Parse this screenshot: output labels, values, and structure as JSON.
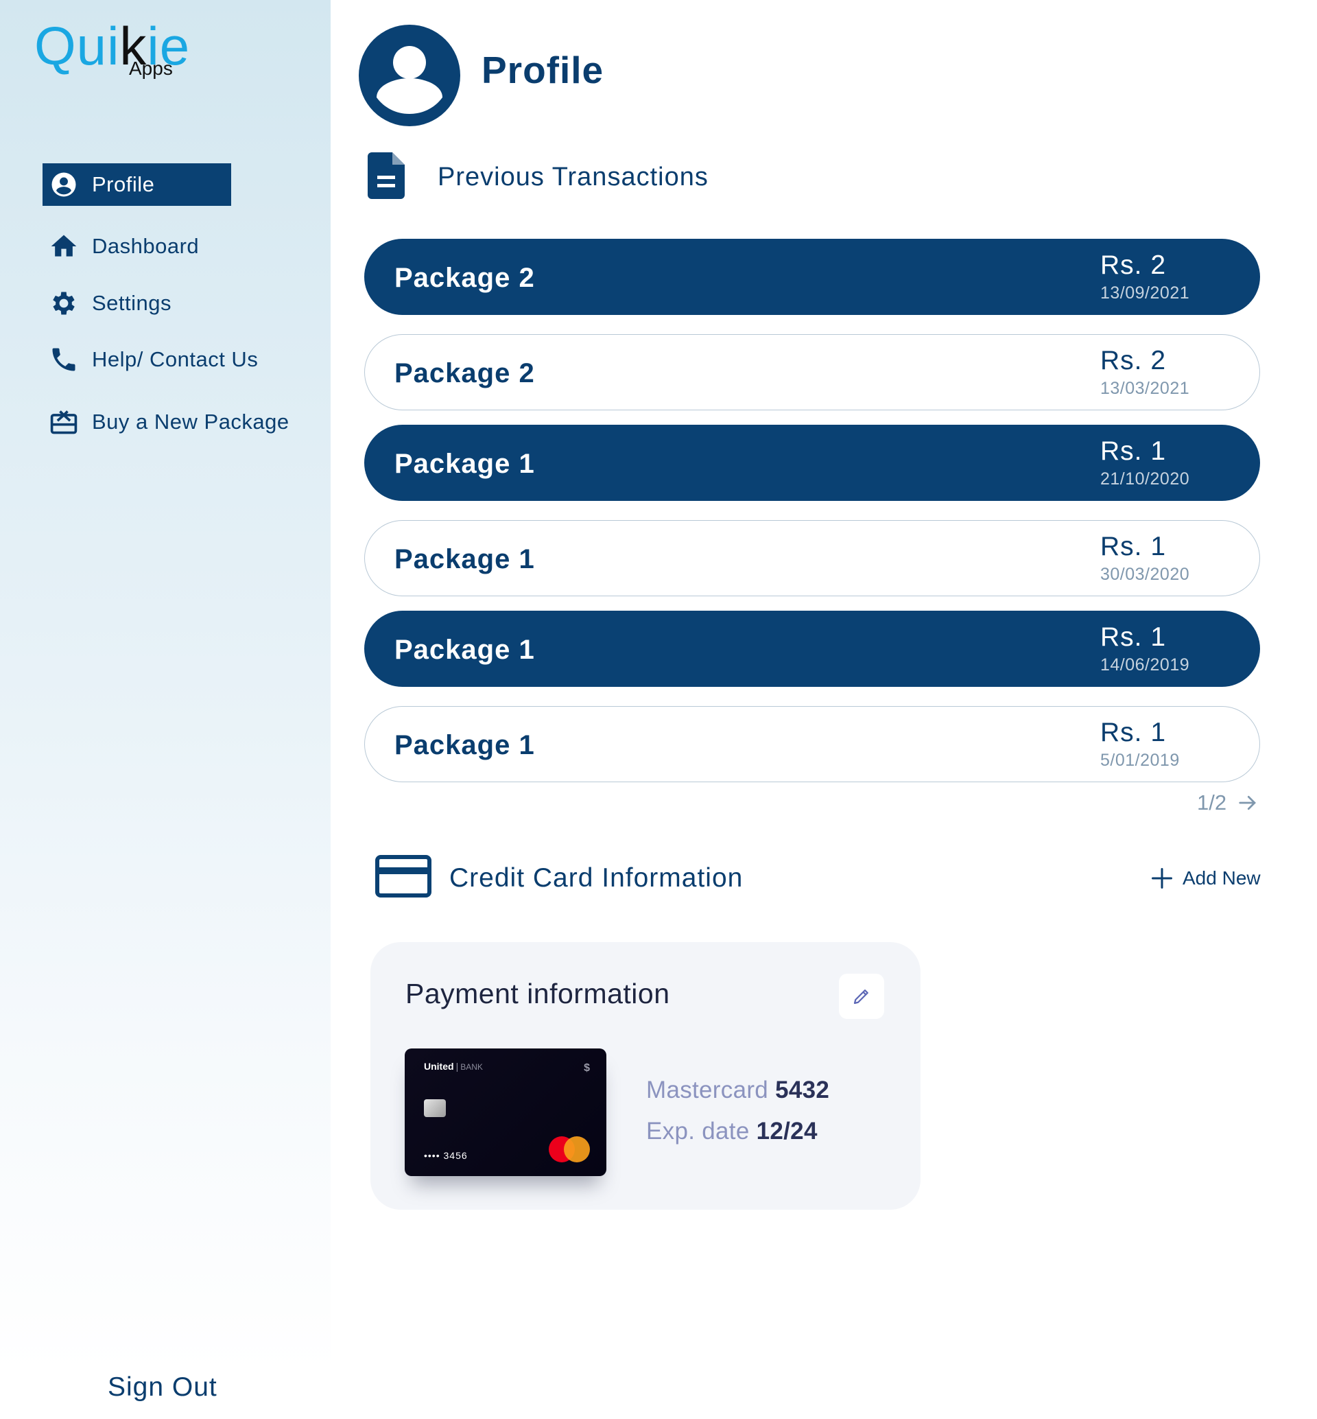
{
  "brand": {
    "logo_main": "Quikie",
    "logo_sub": "Apps",
    "primary_color": "#0a4173",
    "logo_color": "#1aa7e2"
  },
  "sidebar": {
    "items": [
      {
        "label": "Profile",
        "icon": "account-circle-icon",
        "active": true
      },
      {
        "label": "Dashboard",
        "icon": "home-icon",
        "active": false
      },
      {
        "label": "Settings",
        "icon": "gear-icon",
        "active": false
      },
      {
        "label": "Help/ Contact Us",
        "icon": "phone-icon",
        "active": false
      },
      {
        "label": "Buy a New Package",
        "icon": "gift-card-icon",
        "active": false
      }
    ],
    "sign_out": "Sign Out"
  },
  "header": {
    "title": "Profile"
  },
  "transactions": {
    "title": "Previous Transactions",
    "rows": [
      {
        "name": "Package 2",
        "amount": "Rs. 2",
        "date": "13/09/2021",
        "style": "dark"
      },
      {
        "name": "Package 2",
        "amount": "Rs. 2",
        "date": "13/03/2021",
        "style": "light"
      },
      {
        "name": "Package 1",
        "amount": "Rs. 1",
        "date": "21/10/2020",
        "style": "dark"
      },
      {
        "name": "Package 1",
        "amount": "Rs. 1",
        "date": "30/03/2020",
        "style": "light"
      },
      {
        "name": "Package 1",
        "amount": "Rs. 1",
        "date": "14/06/2019",
        "style": "dark"
      },
      {
        "name": "Package 1",
        "amount": "Rs. 1",
        "date": "5/01/2019",
        "style": "light"
      }
    ],
    "pagination": "1/2"
  },
  "credit_card": {
    "title": "Credit Card Information",
    "add_new": "Add New",
    "payment": {
      "title": "Payment information",
      "card_brand": "Mastercard",
      "card_last4": "5432",
      "exp_label": "Exp. date",
      "exp_value": "12/24",
      "card_visual": {
        "bank_name": "United",
        "bank_suffix": "BANK",
        "currency": "$",
        "masked_number": "•••• 3456"
      }
    }
  }
}
